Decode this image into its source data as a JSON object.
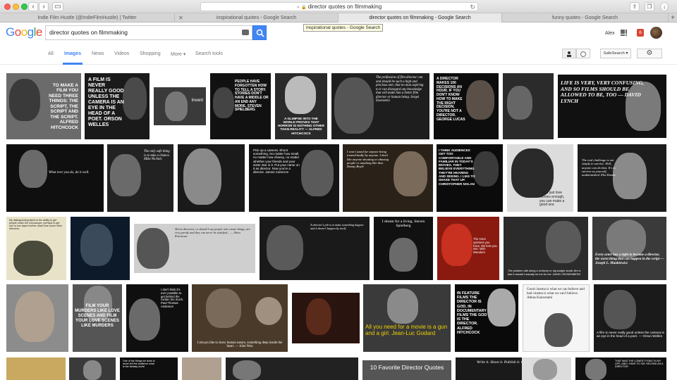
{
  "browser": {
    "url": "director quotes on filmmaking",
    "tabs": [
      {
        "label": "Indie Film Hustle (@IndieFilmHustle) | Twitter",
        "active": false
      },
      {
        "label": "inspirational quotes - Google Search",
        "active": false
      },
      {
        "label": "director quotes on filmmaking - Google Search",
        "active": true
      },
      {
        "label": "funny quotes - Google Search",
        "active": false
      }
    ],
    "tooltip": "inspirational quotes - Google Search"
  },
  "google": {
    "logo": "Google",
    "query": "director quotes on filmmaking",
    "user": "Alex",
    "notifications": "6"
  },
  "nav": {
    "items": [
      "All",
      "Images",
      "News",
      "Videos",
      "Shopping",
      "More ▾",
      "Search tools"
    ],
    "active": "Images",
    "safesearch": "SafeSearch ▾"
  },
  "rows": [
    [
      {
        "caption": "TO MAKE A FILM YOU NEED THREE THINGS: THE SCRIPT, THE SCRIPT AND THE SCRIPT. ALFRED HITCHCOCK",
        "bg": "#6b6b6b",
        "light": false
      },
      {
        "caption": "A FILM IS NEVER REALLY GOOD UNLESS THE CAMERA IS AN EYE IN THE HEAD OF A POET. ORSON WELLES",
        "bg": "#1a1a1a",
        "light": false
      },
      {
        "caption": "Invent",
        "bg": "#3a3a3a",
        "light": false
      },
      {
        "caption": "PEOPLE HAVE FORGOTTEN HOW TO TELL A STORY. STORIES DON'T HAVE A MIDDLE OR AN END ANY MORE. STEVEN SPIELBERG",
        "bg": "#111",
        "light": false
      },
      {
        "caption": "A GLIMPSE INTO THE WORLD PROVES THAT HORROR IS NOTHING OTHER THAN REALITY — ALFRED HITCHCOCK",
        "bg": "#2a2a2a",
        "light": false
      },
      {
        "caption": "The profession of film director can and should be such a high and precious one; that no man aspiring to it can disregard any knowledge that will make him a better film director or human being. Sergei Eisenstein",
        "bg": "#1e1e1e",
        "light": false
      },
      {
        "caption": "A DIRECTOR MAKES 100 DECISIONS AN HOUR. IF YOU DON'T KNOW HOW TO MAKE THE RIGHT DECISION, YOU'RE NOT A DIRECTOR. GEORGE LUCAS",
        "bg": "#0d0d0d",
        "light": false
      },
      {
        "caption": "",
        "bg": "#2b2b2b",
        "light": false
      },
      {
        "caption": "LIFE IS VERY, VERY CONFUSING, AND SO FILMS SHOULD BE ALLOWED TO BE, TOO — DAVID LYNCH",
        "bg": "#111",
        "light": false
      }
    ],
    [
      {
        "caption": "What ever you do, do it well.",
        "bg": "#0f0f0f",
        "light": false
      },
      {
        "caption": "The only safe thing is to take a chance. Mike Nichols",
        "bg": "#222",
        "light": false
      },
      {
        "caption": "",
        "bg": "#1a1a1a",
        "light": false
      },
      {
        "caption": "Pick up a camera. Shoot something. No matter how small, no matter how cheesy, no matter whether your friends and your sister star in it. Put your name on it as director. Now you're a director. James Cameron",
        "bg": "#141414",
        "light": false
      },
      {
        "caption": "I won't stand for anyone being treated badly by anyone. I don't like anyone shouting or abusing people or anything like that. Danny Boyle",
        "bg": "#2a2219",
        "light": false
      },
      {
        "caption": "I THINK AUDIENCES GET TOO COMFORTABLE AND FAMILIAR IN TODAY'S MOVIES. THEY BELIEVE EVERYTHING THEY'RE HEARING AND SEEING. I LIKE TO SHAKE THAT UP. CHRISTOPHER NOLAN",
        "bg": "#0b0b0b",
        "light": false
      },
      {
        "caption": "If you just love movies enough, you can make a good one",
        "bg": "#dcdcdc",
        "light": true
      },
      {
        "caption": "The real challenge is not simply to survive. Hell, anyone can do that. It's to survive as yourself, undiminished. Elia Kazan",
        "bg": "#1c1c1c",
        "light": false
      }
    ],
    [
      {
        "caption": "My distinguishing talent is the ability to get people under the microscope, perhaps to get one or two layers further down than some other directors.",
        "bg": "#e8e2c8",
        "light": true
      },
      {
        "caption": "",
        "bg": "#0d1a2a",
        "light": false
      },
      {
        "caption": "Movie directors, or should I say people who create things, are very greedy and they can never be satisfied... — Akira Kurosawa",
        "bg": "#cfcfcf",
        "light": true
      },
      {
        "caption": "A director's job is to make something happen and it doesn't happen by itself.",
        "bg": "#1a1a1a",
        "light": false
      },
      {
        "caption": "I dream for a living. Steven Spielberg",
        "bg": "#111",
        "light": false
      },
      {
        "caption": "The more opinions you have, the less you see. Wim Wenders",
        "bg": "#8a1a10",
        "light": false
      },
      {
        "caption": "The problem with doing a schlocky or big budget studio film is that it wouldn't actually be fun for me. DAVID CRONENBERG",
        "bg": "#2b2b2b",
        "light": false
      },
      {
        "caption": "Every actor has a right to become a director, the worst thing that can happen in the script — Joseph L. Mankiewicz",
        "bg": "#3a3a3a",
        "light": false
      }
    ],
    [
      {
        "caption": "",
        "bg": "#8c8c8c",
        "light": false
      },
      {
        "caption": "FILM YOUR MURDERS LIKE LOVE SCENES AND FILM YOUR LOVE SCENES LIKE MURDERS",
        "bg": "#555",
        "light": false
      },
      {
        "caption": "I don't think it's ever possible to get behind the curtain too much. Paul Thomas Anderson",
        "bg": "#0f0f0f",
        "light": false
      },
      {
        "caption": "I always like to show human nature, something deep inside the heart. — John Woo",
        "bg": "#4a3a2a",
        "light": false
      },
      {
        "caption": "",
        "bg": "#2a1410",
        "light": false
      },
      {
        "caption": "All you need for a movie is a gun and a girl. Jean-Luc Godard",
        "bg": "#3a3a3a",
        "light": false
      },
      {
        "caption": "IN FEATURE FILMS THE DIRECTOR IS GOD, IN DOCUMENTARY FILMS THE GOD IS THE DIRECTOR. ALFRED HITCHCOCK",
        "bg": "#0a0a0a",
        "light": false
      },
      {
        "caption": "Good cinema is what we can believe and bad cinema is what we can't believe. Abbas Kiarostami",
        "bg": "#f5f5f5",
        "light": true
      },
      {
        "caption": "A film is never really good unless the camera is an eye in the head of a poet. — Orson Welles",
        "bg": "#1a1a1a",
        "light": false
      }
    ],
    [
      {
        "caption": "",
        "bg": "#c9a860",
        "light": false
      },
      {
        "caption": "",
        "bg": "#3a3a3a",
        "light": false
      },
      {
        "caption": "One of the things we learn is never tell the audience what is the fantasy world",
        "bg": "#0f0f0f",
        "light": false
      },
      {
        "caption": "",
        "bg": "#b0a090",
        "light": false
      },
      {
        "caption": "",
        "bg": "#222",
        "light": false
      },
      {
        "caption": "10 Favorite Director Quotes",
        "bg": "#555",
        "light": false
      },
      {
        "caption": "Write it. Shoot it. Publish it. Crochet it.",
        "bg": "#1a1a1a",
        "light": false
      },
      {
        "caption": "",
        "bg": "#dcdcdc",
        "light": true
      },
      {
        "caption": "THAT WAS THE LOWEST POINT IN MY LIFE, AND I HAVE TO SAY SECOND AS A DIRECTOR",
        "bg": "#111",
        "light": false
      }
    ]
  ]
}
